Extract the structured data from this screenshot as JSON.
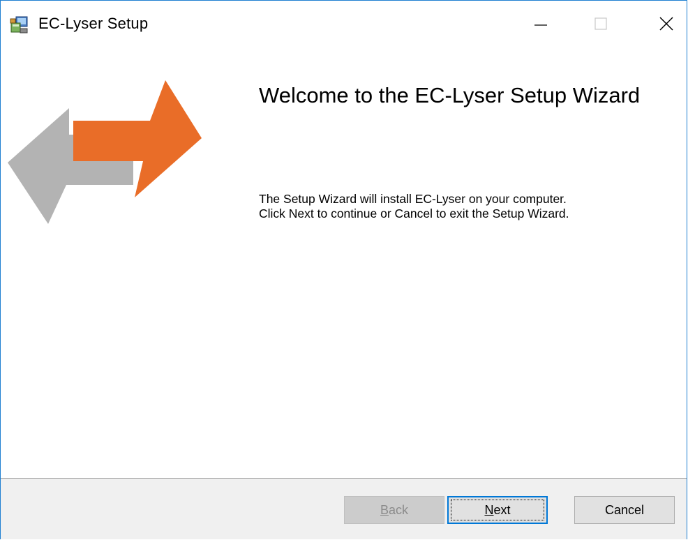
{
  "window": {
    "title": "EC-Lyser Setup",
    "icon": "installer-icon",
    "controls": {
      "minimize_icon": "minimize-icon",
      "maximize_icon": "maximize-icon",
      "close_icon": "close-icon"
    }
  },
  "wizard": {
    "heading": "Welcome to the EC-Lyser Setup Wizard",
    "description_line1": "The Setup Wizard will install EC-Lyser on your computer.",
    "description_line2": "Click Next to continue or Cancel to exit the Setup Wizard.",
    "graphic": "swap-arrows-graphic",
    "colors": {
      "orange_arrow": "#e96d28",
      "gray_arrow": "#b3b3b3"
    }
  },
  "buttons": {
    "back": {
      "mnemonic": "B",
      "rest": "ack",
      "enabled": false
    },
    "next": {
      "mnemonic": "N",
      "rest": "ext",
      "focused": true
    },
    "cancel": {
      "label": "Cancel"
    }
  },
  "colors": {
    "window_border": "#1e7fd1",
    "footer_bg": "#f0f0f0",
    "focus_border": "#0078d7"
  }
}
